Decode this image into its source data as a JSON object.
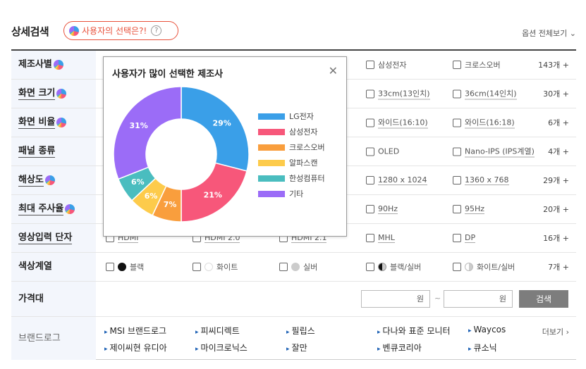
{
  "header": {
    "title": "상세검색",
    "pick_label": "사용자의 선택은?!",
    "help_glyph": "?",
    "options_label": "옵션 전체보기 ⌄"
  },
  "rows": [
    {
      "label": "제조사별",
      "underline": false,
      "pie": true,
      "options": [
        "삼성전자",
        "크로스오버"
      ],
      "count": "143개 +"
    },
    {
      "label": "화면 크기",
      "underline": true,
      "pie": true,
      "options": [
        "33cm(13인치)",
        "36cm(14인치)"
      ],
      "count": "30개 +"
    },
    {
      "label": "화면 비율",
      "underline": true,
      "pie": true,
      "options": [
        "와이드(16:10)",
        "와이드(16:18)"
      ],
      "count": "6개 +"
    },
    {
      "label": "패널 종류",
      "underline": true,
      "pie": false,
      "options": [
        "OLED",
        "Nano-IPS (IPS계열)"
      ],
      "count": "4개 +"
    },
    {
      "label": "해상도",
      "underline": true,
      "pie": true,
      "options": [
        "1280 x 1024",
        "1360 x 768"
      ],
      "count": "29개 +"
    },
    {
      "label": "최대 주사율",
      "underline": true,
      "pie": true,
      "options": [
        "90Hz",
        "95Hz"
      ],
      "count": "20개 +"
    },
    {
      "label": "영상입력 단자",
      "underline": true,
      "pie": false,
      "options": [
        "HDMI",
        "HDMI 2.0",
        "HDMI 2.1",
        "MHL",
        "DP"
      ],
      "count": "16개 +"
    },
    {
      "label": "색상계열",
      "underline": false,
      "pie": false,
      "options": [
        "블랙",
        "화이트",
        "실버",
        "블랙/실버",
        "화이트/실버"
      ],
      "count": "7개 +"
    }
  ],
  "price": {
    "label": "가격대",
    "min_unit": "원",
    "max_unit": "원",
    "separator": "~",
    "search_label": "검색"
  },
  "brand_log": {
    "label": "브랜드로그",
    "items": [
      "MSI 브랜드로그",
      "피씨디렉트",
      "필립스",
      "다나와 표준 모니터",
      "Waycos",
      "제이씨현 유디아",
      "마이크로닉스",
      "잘만",
      "벤큐코리아",
      "큐소닉"
    ],
    "more_label": "더보기 ›"
  },
  "popup": {
    "title": "사용자가 많이 선택한 제조사",
    "close_glyph": "✕"
  },
  "chart_data": {
    "type": "pie",
    "title": "사용자가 많이 선택한 제조사",
    "donut": true,
    "categories": [
      "LG전자",
      "삼성전자",
      "크로스오버",
      "알파스캔",
      "한성컴퓨터",
      "기타"
    ],
    "values": [
      29,
      21,
      7,
      6,
      6,
      31
    ],
    "colors": [
      "#3a9fe8",
      "#f7577a",
      "#f99e3d",
      "#fdcb4b",
      "#4abdbf",
      "#9b6cf7"
    ],
    "legend_position": "right"
  }
}
